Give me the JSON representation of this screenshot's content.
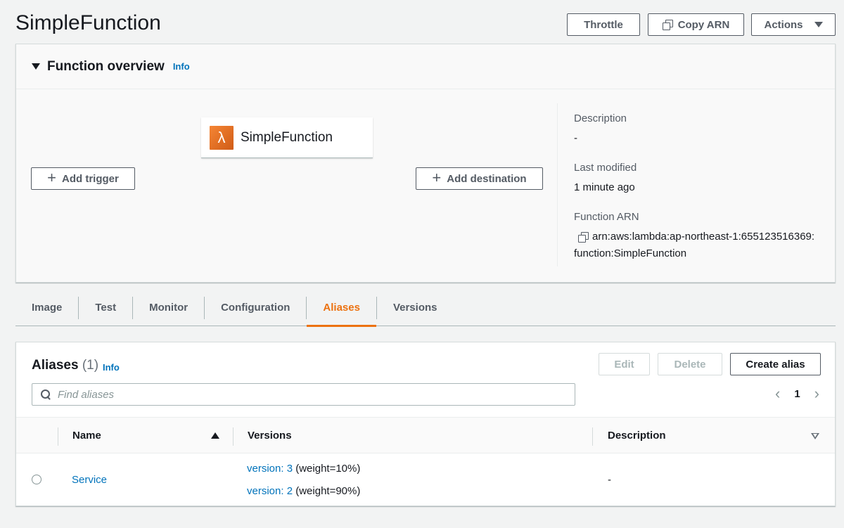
{
  "header": {
    "title": "SimpleFunction",
    "throttle_label": "Throttle",
    "copy_arn_label": "Copy ARN",
    "actions_label": "Actions"
  },
  "overview": {
    "title": "Function overview",
    "info_label": "Info",
    "function_name": "SimpleFunction",
    "add_trigger_label": "Add trigger",
    "add_destination_label": "Add destination",
    "description_label": "Description",
    "description_value": "-",
    "last_modified_label": "Last modified",
    "last_modified_value": "1 minute ago",
    "function_arn_label": "Function ARN",
    "function_arn_line1": "arn:aws:lambda:ap-northeast-1:655123516369:",
    "function_arn_line2": "function:SimpleFunction"
  },
  "tabs": [
    {
      "label": "Image",
      "active": false
    },
    {
      "label": "Test",
      "active": false
    },
    {
      "label": "Monitor",
      "active": false
    },
    {
      "label": "Configuration",
      "active": false
    },
    {
      "label": "Aliases",
      "active": true
    },
    {
      "label": "Versions",
      "active": false
    }
  ],
  "aliases": {
    "title": "Aliases",
    "count": "(1)",
    "info_label": "Info",
    "edit_label": "Edit",
    "delete_label": "Delete",
    "create_label": "Create alias",
    "search_placeholder": "Find aliases",
    "page": "1",
    "columns": {
      "name": "Name",
      "versions": "Versions",
      "description": "Description"
    },
    "rows": [
      {
        "name": "Service",
        "versions": [
          {
            "link": "version: 3",
            "weight": "(weight=10%)"
          },
          {
            "link": "version: 2",
            "weight": "(weight=90%)"
          }
        ],
        "description": "-"
      }
    ]
  },
  "colors": {
    "accent": "#ec7211",
    "link": "#0073bb"
  }
}
